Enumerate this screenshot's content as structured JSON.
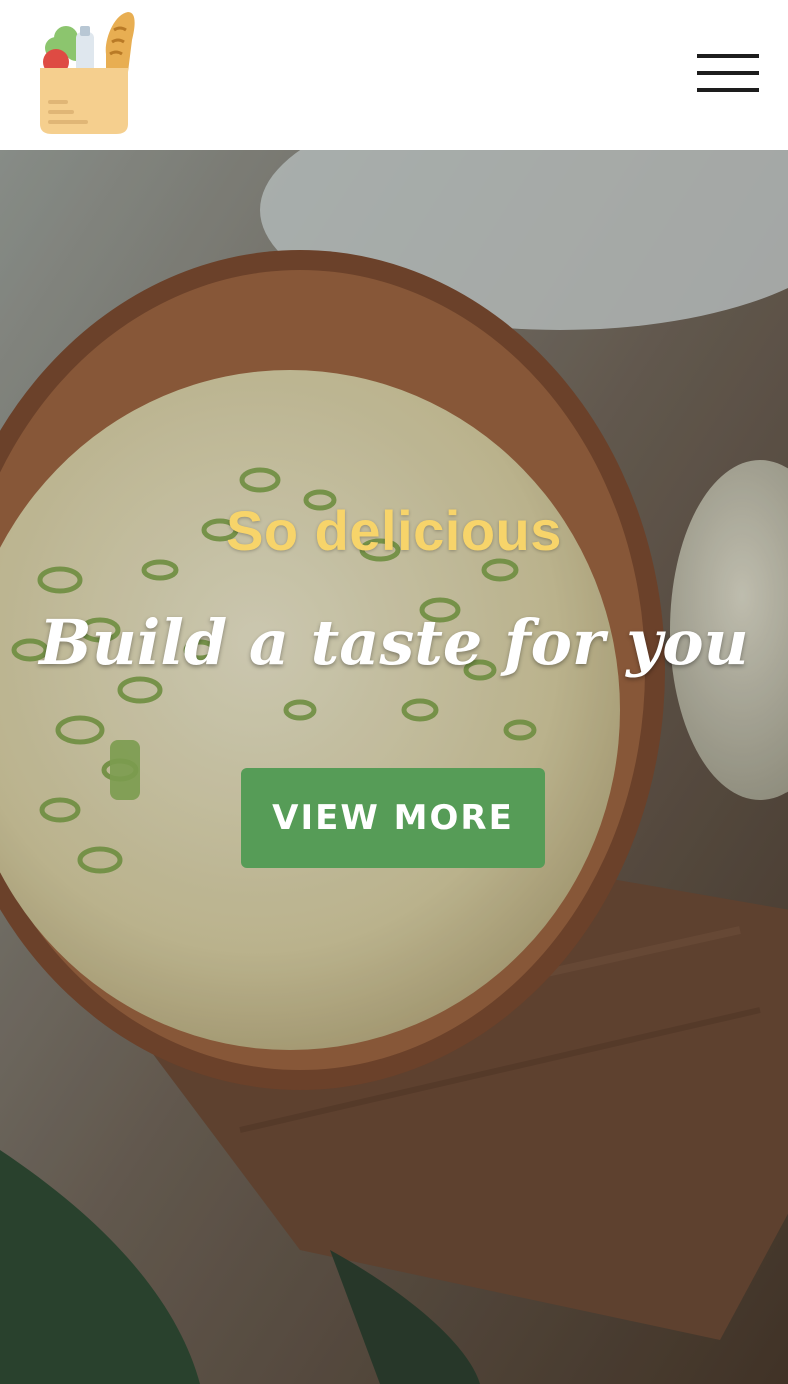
{
  "header": {
    "logo_icon": "grocery-bag-icon",
    "menu_icon": "hamburger-menu-icon"
  },
  "hero": {
    "kicker": "So delicious",
    "title": "Build a taste for you",
    "cta_label": "VIEW MORE"
  },
  "colors": {
    "kicker": "#f7d46a",
    "cta_background": "#569c57",
    "header_background": "#ffffff"
  }
}
